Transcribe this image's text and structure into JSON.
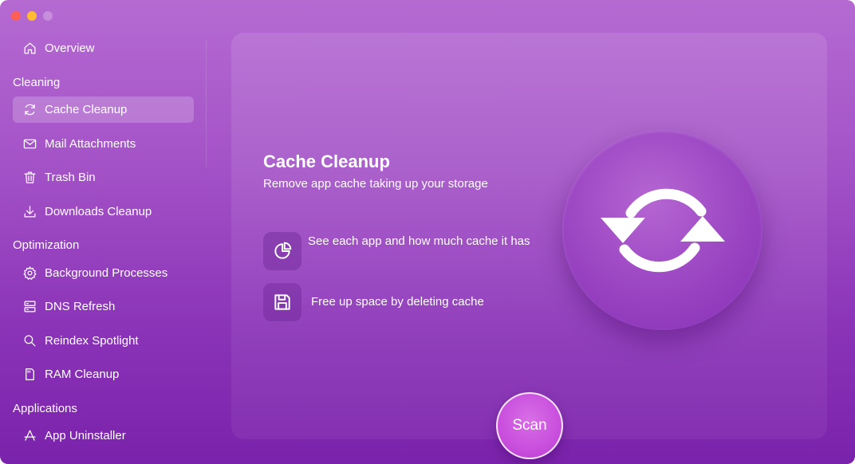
{
  "window": {
    "controls": [
      "close",
      "minimize",
      "zoom"
    ]
  },
  "sidebar": {
    "overview": {
      "label": "Overview",
      "icon": "home-icon"
    },
    "sections": [
      {
        "title": "Cleaning",
        "items": [
          {
            "label": "Cache Cleanup",
            "icon": "refresh-icon",
            "active": true
          },
          {
            "label": "Mail Attachments",
            "icon": "mail-icon"
          },
          {
            "label": "Trash Bin",
            "icon": "trash-icon"
          },
          {
            "label": "Downloads Cleanup",
            "icon": "download-icon"
          }
        ]
      },
      {
        "title": "Optimization",
        "items": [
          {
            "label": "Background Processes",
            "icon": "gear-icon"
          },
          {
            "label": "DNS Refresh",
            "icon": "server-icon"
          },
          {
            "label": "Reindex Spotlight",
            "icon": "search-icon"
          },
          {
            "label": "RAM Cleanup",
            "icon": "memory-card-icon"
          }
        ]
      },
      {
        "title": "Applications",
        "items": [
          {
            "label": "App Uninstaller",
            "icon": "app-store-icon"
          }
        ]
      }
    ]
  },
  "main": {
    "title": "Cache Cleanup",
    "subtitle": "Remove app cache taking up your storage",
    "features": [
      {
        "icon": "pie-chart-icon",
        "text": "See each app and how much cache it has"
      },
      {
        "icon": "floppy-disk-icon",
        "text": "Free up space by deleting cache"
      }
    ],
    "hero_icon": "refresh-icon",
    "scan_label": "Scan"
  },
  "colors": {
    "accent": "#c94fdd",
    "background_top": "#b56ad2",
    "background_bottom": "#7a22ab"
  }
}
